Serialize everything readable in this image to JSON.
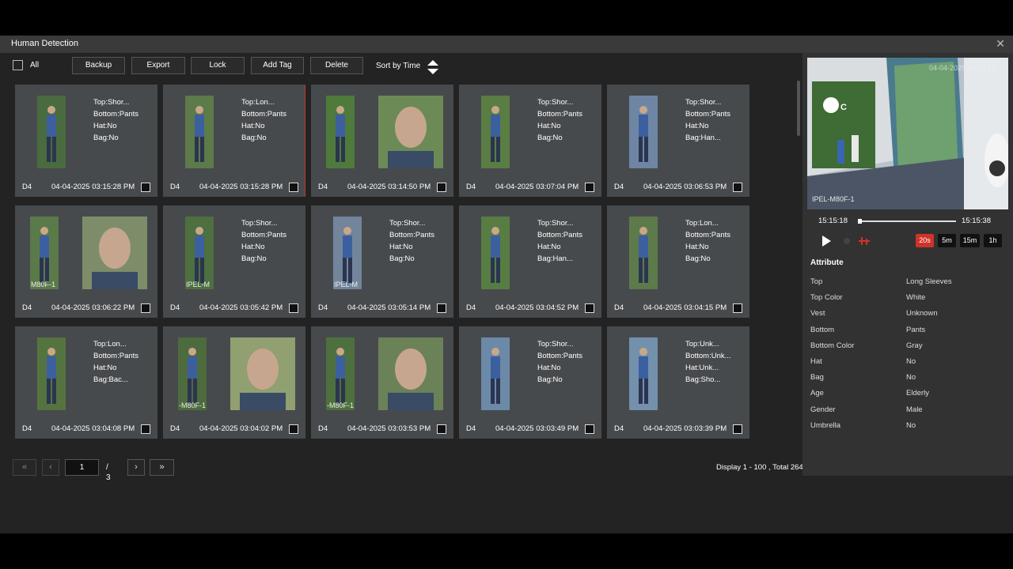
{
  "window": {
    "title": "Human Detection",
    "close": "✕"
  },
  "toolbar": {
    "all_label": "All",
    "buttons": [
      "Backup",
      "Export",
      "Lock",
      "Add Tag",
      "Delete"
    ],
    "sort_label": "Sort by Time"
  },
  "cards": [
    {
      "channel": "D4",
      "time": "04-04-2025 03:15:28 PM",
      "attrs": [
        "Top:Shor...",
        "Bottom:Pants",
        "Hat:No",
        "Bag:No"
      ],
      "thumb": "#4a6b3f",
      "face": null
    },
    {
      "channel": "D4",
      "time": "04-04-2025 03:15:28 PM",
      "attrs": [
        "Top:Lon...",
        "Bottom:Pants",
        "Hat:No",
        "Bag:No"
      ],
      "thumb": "#5d7a4a",
      "face": null,
      "selected": true
    },
    {
      "channel": "D4",
      "time": "04-04-2025 03:14:50 PM",
      "attrs": [],
      "thumb": "#4f7a3b",
      "face": "#6c8a56"
    },
    {
      "channel": "D4",
      "time": "04-04-2025 03:07:04 PM",
      "attrs": [
        "Top:Shor...",
        "Bottom:Pants",
        "Hat:No",
        "Bag:No"
      ],
      "thumb": "#5a7d44",
      "face": null
    },
    {
      "channel": "D4",
      "time": "04-04-2025 03:06:53 PM",
      "attrs": [
        "Top:Shor...",
        "Bottom:Pants",
        "Hat:No",
        "Bag:Han..."
      ],
      "thumb": "#6e86a4",
      "face": null
    },
    {
      "channel": "D4",
      "time": "04-04-2025 03:06:22 PM",
      "attrs": [],
      "thumb": "#5b7a49",
      "face": "#7d8d6a",
      "thumb_label": "M80F-1"
    },
    {
      "channel": "D4",
      "time": "04-04-2025 03:05:42 PM",
      "attrs": [
        "Top:Shor...",
        "Bottom:Pants",
        "Hat:No",
        "Bag:No"
      ],
      "thumb": "#4e6f3f",
      "face": null,
      "thumb_label": "IPEL-M"
    },
    {
      "channel": "D4",
      "time": "04-04-2025 03:05:14 PM",
      "attrs": [
        "Top:Shor...",
        "Bottom:Pants",
        "Hat:No",
        "Bag:No"
      ],
      "thumb": "#73859b",
      "face": null,
      "thumb_label": "IPEL-M"
    },
    {
      "channel": "D4",
      "time": "04-04-2025 03:04:52 PM",
      "attrs": [
        "Top:Shor...",
        "Bottom:Pants",
        "Hat:No",
        "Bag:Han..."
      ],
      "thumb": "#587d43",
      "face": null
    },
    {
      "channel": "D4",
      "time": "04-04-2025 03:04:15 PM",
      "attrs": [
        "Top:Lon...",
        "Bottom:Pants",
        "Hat:No",
        "Bag:No"
      ],
      "thumb": "#5d7a4b",
      "face": null
    },
    {
      "channel": "D4",
      "time": "04-04-2025 03:04:08 PM",
      "attrs": [
        "Top:Lon...",
        "Bottom:Pants",
        "Hat:No",
        "Bag:Bac..."
      ],
      "thumb": "#55733f",
      "face": null
    },
    {
      "channel": "D4",
      "time": "04-04-2025 03:04:02 PM",
      "attrs": [],
      "thumb": "#4d6b3d",
      "face": "#90a071",
      "thumb_label": "-M80F-1"
    },
    {
      "channel": "D4",
      "time": "04-04-2025 03:03:53 PM",
      "attrs": [],
      "thumb": "#4e703e",
      "face": "#6b8158",
      "thumb_label": "-M80F-1"
    },
    {
      "channel": "D4",
      "time": "04-04-2025 03:03:49 PM",
      "attrs": [
        "Top:Shor...",
        "Bottom:Pants",
        "Hat:No",
        "Bag:No"
      ],
      "thumb": "#6c89a8",
      "face": null
    },
    {
      "channel": "D4",
      "time": "04-04-2025 03:03:39 PM",
      "attrs": [
        "Top:Unk...",
        "Bottom:Unk...",
        "Hat:Unk...",
        "Bag:Sho..."
      ],
      "thumb": "#7390ad",
      "face": null
    }
  ],
  "pager": {
    "first": "«",
    "prev": "‹",
    "page": "1",
    "total": "/ 3",
    "next": "›",
    "last": "»"
  },
  "display": "Display 1 - 100 , Total 264",
  "player": {
    "watermark": "04-04-2025 Fri 15:15:...",
    "camera_label": "IPEL-M80F-1",
    "start_time": "15:15:18",
    "end_time": "15:15:38",
    "progress": 0.0,
    "zoom": [
      {
        "label": "20s",
        "active": true
      },
      {
        "label": "5m",
        "active": false
      },
      {
        "label": "15m",
        "active": false
      },
      {
        "label": "1h",
        "active": false
      }
    ]
  },
  "attribute": {
    "heading": "Attribute",
    "rows": [
      {
        "k": "Top",
        "v": "Long Sleeves"
      },
      {
        "k": "Top Color",
        "v": "White"
      },
      {
        "k": "Vest",
        "v": "Unknown"
      },
      {
        "k": "Bottom",
        "v": "Pants"
      },
      {
        "k": "Bottom Color",
        "v": "Gray"
      },
      {
        "k": "Hat",
        "v": "No"
      },
      {
        "k": "Bag",
        "v": "No"
      },
      {
        "k": "Age",
        "v": "Elderly"
      },
      {
        "k": "Gender",
        "v": "Male"
      },
      {
        "k": "Umbrella",
        "v": "No"
      }
    ]
  },
  "colors": {
    "accent": "#d0322a",
    "card_bg": "#474a4d",
    "window_bg": "#232323"
  }
}
